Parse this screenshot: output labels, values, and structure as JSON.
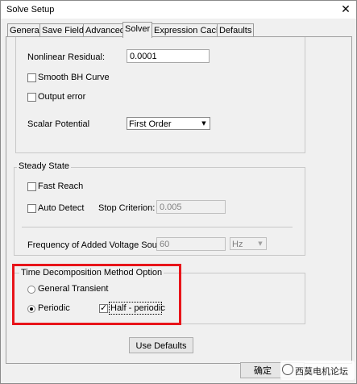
{
  "window": {
    "title": "Solve Setup",
    "close_glyph": "✕"
  },
  "tabs": [
    {
      "label": "General"
    },
    {
      "label": "Save Fields"
    },
    {
      "label": "Advanced"
    },
    {
      "label": "Solver",
      "active": true
    },
    {
      "label": "Expression Cache"
    },
    {
      "label": "Defaults"
    }
  ],
  "solver": {
    "nonlinear_residual_label": "Nonlinear Residual:",
    "nonlinear_residual_value": "0.0001",
    "smooth_bh_label": "Smooth BH Curve",
    "smooth_bh_checked": false,
    "output_error_label": "Output error",
    "output_error_checked": false,
    "scalar_potential_label": "Scalar Potential",
    "scalar_potential_value": "First Order"
  },
  "steady_state": {
    "group_label": "Steady State",
    "fast_reach_label": "Fast Reach",
    "auto_detect_label": "Auto Detect",
    "stop_criterion_label": "Stop Criterion:",
    "stop_criterion_value": "0.005",
    "freq_label": "Frequency of Added Voltage Source",
    "freq_value": "60",
    "freq_unit": "Hz"
  },
  "time_decomp": {
    "group_label": "Time Decomposition Method Option",
    "general_transient_label": "General Transient",
    "periodic_label": "Periodic",
    "periodic_selected": true,
    "half_periodic_label": "Half - periodic",
    "half_periodic_checked": true
  },
  "buttons": {
    "use_defaults": "Use Defaults",
    "ok": "确定"
  },
  "watermark": "西莫电机论坛",
  "colors": {
    "highlight": "#e8141a",
    "background": "#f0f0f0"
  }
}
